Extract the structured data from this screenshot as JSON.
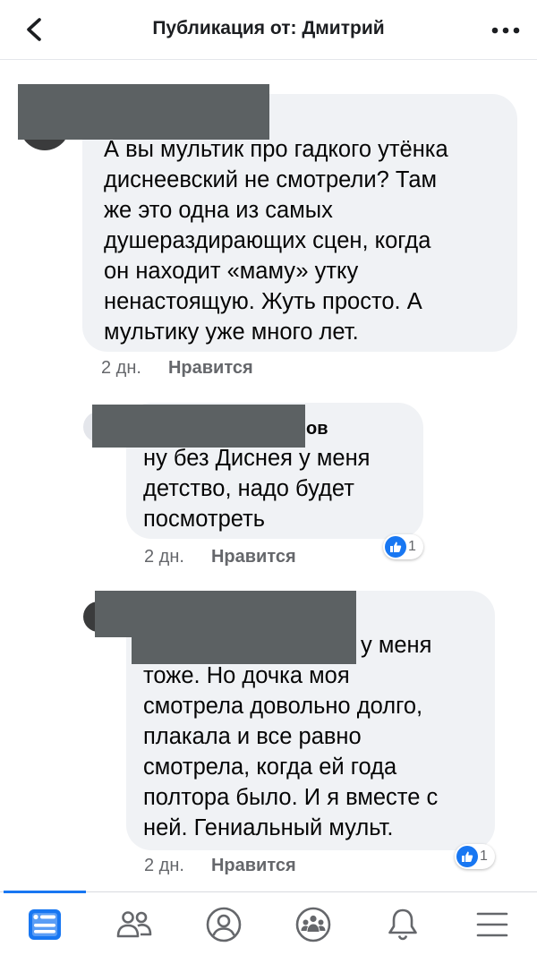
{
  "header": {
    "title": "Публикация от: Дмитрий"
  },
  "comments": [
    {
      "text": "А вы мультик про гадкого утёнка\nдиснеевский не смотрели? Там\nже это одна из самых\nдушераздирающих сцен, когда\nон находит «маму» утку\nненастоящую. Жуть просто. А\nмультику уже много лет.",
      "time": "2 дн.",
      "like_label": "Нравится"
    },
    {
      "author_suffix": "ов",
      "text": "ну без Диснея у меня\nдетство, надо будет\nпосмотреть",
      "time": "2 дн.",
      "like_label": "Нравится",
      "reactions": "1"
    },
    {
      "text_first": "у меня",
      "text": "тоже. Но дочка моя\nсмотрела довольно долго,\nплакала и все равно\nсмотрела, когда ей года\nполтора было. И я вместе с\nней. Гениальный мульт.",
      "time": "2 дн.",
      "like_label": "Нравится",
      "reactions": "1"
    }
  ],
  "nav": {
    "items": [
      "feed-icon",
      "friends-icon",
      "profile-icon",
      "groups-icon",
      "notifications-icon",
      "menu-icon"
    ],
    "active": "feed-icon"
  },
  "colors": {
    "accent": "#1877f2",
    "bubble": "#f0f2f5",
    "secondary_text": "#65676b",
    "redaction": "#5c6163"
  }
}
